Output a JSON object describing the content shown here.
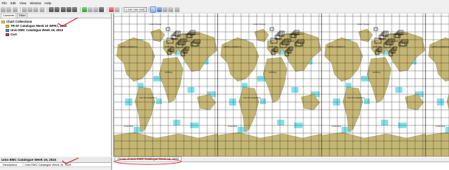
{
  "menubar": {
    "items": [
      "File",
      "Edit",
      "View",
      "Window",
      "Help"
    ]
  },
  "toolbar": {
    "scale_value": "1:200 000 000",
    "buttons": [
      "open-icon",
      "save-icon",
      "print-icon",
      "cut-icon",
      "copy-icon",
      "paste-icon",
      "undo-icon",
      "redo-icon",
      "layers-icon",
      "route-icon",
      "catalog-icon",
      "grid-icon",
      "refresh-icon",
      "table-icon",
      "filter-icon",
      "pin-icon",
      "zoom-in-icon",
      "zoom-out-icon",
      "pan-icon",
      "fit-icon",
      "measure-icon",
      "select-icon",
      "info-icon"
    ]
  },
  "left_panel": {
    "tabs": [
      "Contents",
      "Filter"
    ],
    "tree": {
      "root": "Chart Collections",
      "items": [
        {
          "label": "TR-97 Catalogue Week 10 WFR7, 2024",
          "selected": false
        },
        {
          "label": "Unio EMC Catalogue Week 19, 2024",
          "selected": true
        }
      ],
      "cart": "Cart"
    }
  },
  "bottom_left": {
    "title": "Unio EMC Catalogue Week 19, 2024",
    "property_key": "Description",
    "property_value": "Unio EMC Catalogue Week 19, 2024"
  },
  "bottom_right": {
    "tab_label": "Charts of Unio EMC Catalogue Week 19, 2024"
  },
  "map": {
    "repeats": 4,
    "labels": [
      "Russian Federation",
      "Antarctica",
      "NORTH AMERICA",
      "SOUTH AMERICA",
      "EUROPE",
      "AFRICA",
      "ASIA",
      "Arctic Ocean"
    ],
    "colors": {
      "land": "#c6b673",
      "water": "#ffffff",
      "coverage": "#7fe3ee",
      "grid": "#222222",
      "annotation": "#d42020"
    }
  }
}
